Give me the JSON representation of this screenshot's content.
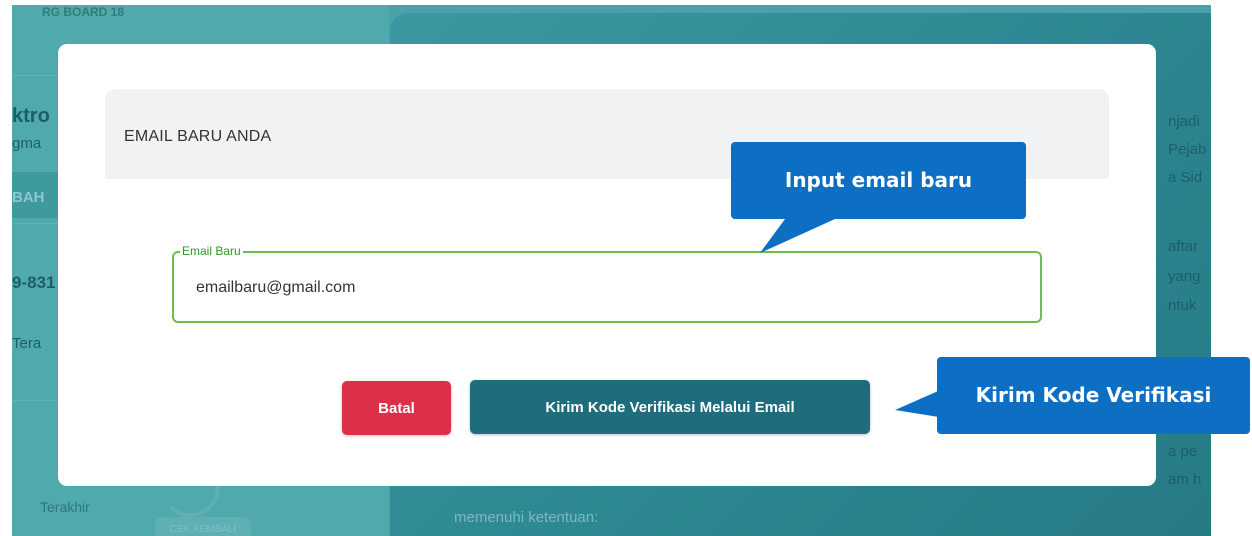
{
  "background": {
    "badge": "RG BOARD 18",
    "sidebar_fragments": [
      "ktro",
      "gma",
      "BAH",
      "9-831",
      "Tera",
      "Terakhir"
    ],
    "main_fragments": [
      "njadi",
      "Pejab",
      "a Sid",
      "aftar",
      "yang",
      "ntuk",
      "a pe",
      "am h",
      "memenuhi ketentuan:"
    ],
    "pill": "CEK KEMBALI"
  },
  "modal": {
    "title": "EMAIL BARU ANDA",
    "field": {
      "label": "Email Baru",
      "value": "emailbaru@gmail.com"
    },
    "buttons": {
      "cancel": "Batal",
      "send": "Kirim Kode Verifikasi Melalui Email"
    }
  },
  "callouts": {
    "input_email": "Input email baru",
    "send_code": "Kirim Kode Verifikasi"
  },
  "colors": {
    "callout": "#0d6fc4",
    "cancel": "#dc3048",
    "send": "#1f6c7c",
    "field_border": "#6cbf4c",
    "field_label": "#2e9a28",
    "backdrop": "#4aa2a8"
  }
}
